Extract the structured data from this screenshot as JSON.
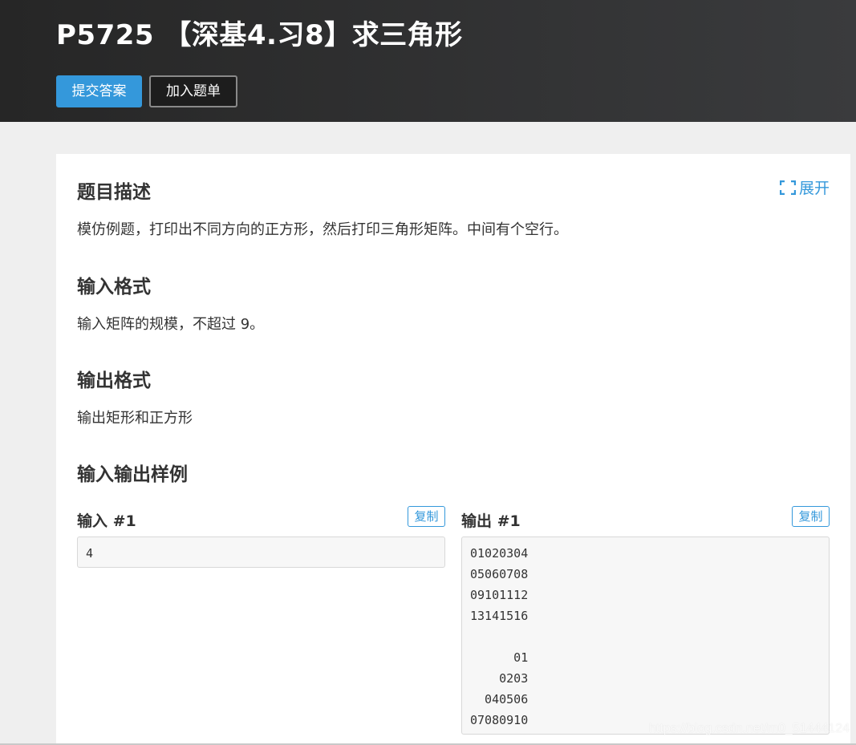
{
  "header": {
    "title": "P5725 【深基4.习8】求三角形",
    "submit_label": "提交答案",
    "add_label": "加入题单"
  },
  "content": {
    "expand_label": "展开",
    "expand_icon": "expand-icon",
    "sections": [
      {
        "title": "题目描述",
        "text": "模仿例题，打印出不同方向的正方形，然后打印三角形矩阵。中间有个空行。"
      },
      {
        "title": "输入格式",
        "text": "输入矩阵的规模，不超过 9。"
      },
      {
        "title": "输出格式",
        "text": "输出矩形和正方形"
      }
    ],
    "samples_title": "输入输出样例",
    "sample_input": {
      "label": "输入 #1",
      "copy_label": "复制",
      "value": "4"
    },
    "sample_output": {
      "label": "输出 #1",
      "copy_label": "复制",
      "value": "01020304\n05060708\n09101112\n13141516\n\n      01\n    0203\n  040506\n07080910"
    }
  },
  "watermark": "https://blog.csdn.net/m0_51444124",
  "colors": {
    "accent": "#3498db",
    "header_dark": "#262626",
    "background": "#efefef"
  }
}
